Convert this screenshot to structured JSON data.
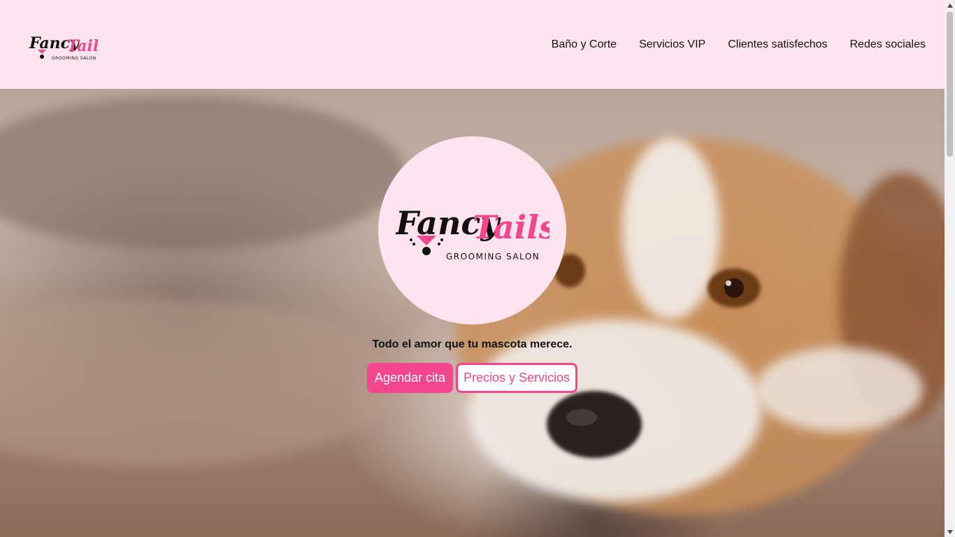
{
  "brand": {
    "logo_word1": "Fancy",
    "logo_word2": "Tails",
    "logo_subtitle": "GROOMING SALON"
  },
  "nav": {
    "items": [
      {
        "label": "Baño y Corte"
      },
      {
        "label": "Servicios VIP"
      },
      {
        "label": "Clientes satisfechos"
      },
      {
        "label": "Redes sociales"
      }
    ]
  },
  "hero": {
    "tagline": "Todo el amor que tu mascota merece.",
    "primary_button": "Agendar cita",
    "secondary_button": "Precios y Servicios"
  },
  "colors": {
    "accent": "#f2468f",
    "header_bg": "#ffe4ef"
  }
}
